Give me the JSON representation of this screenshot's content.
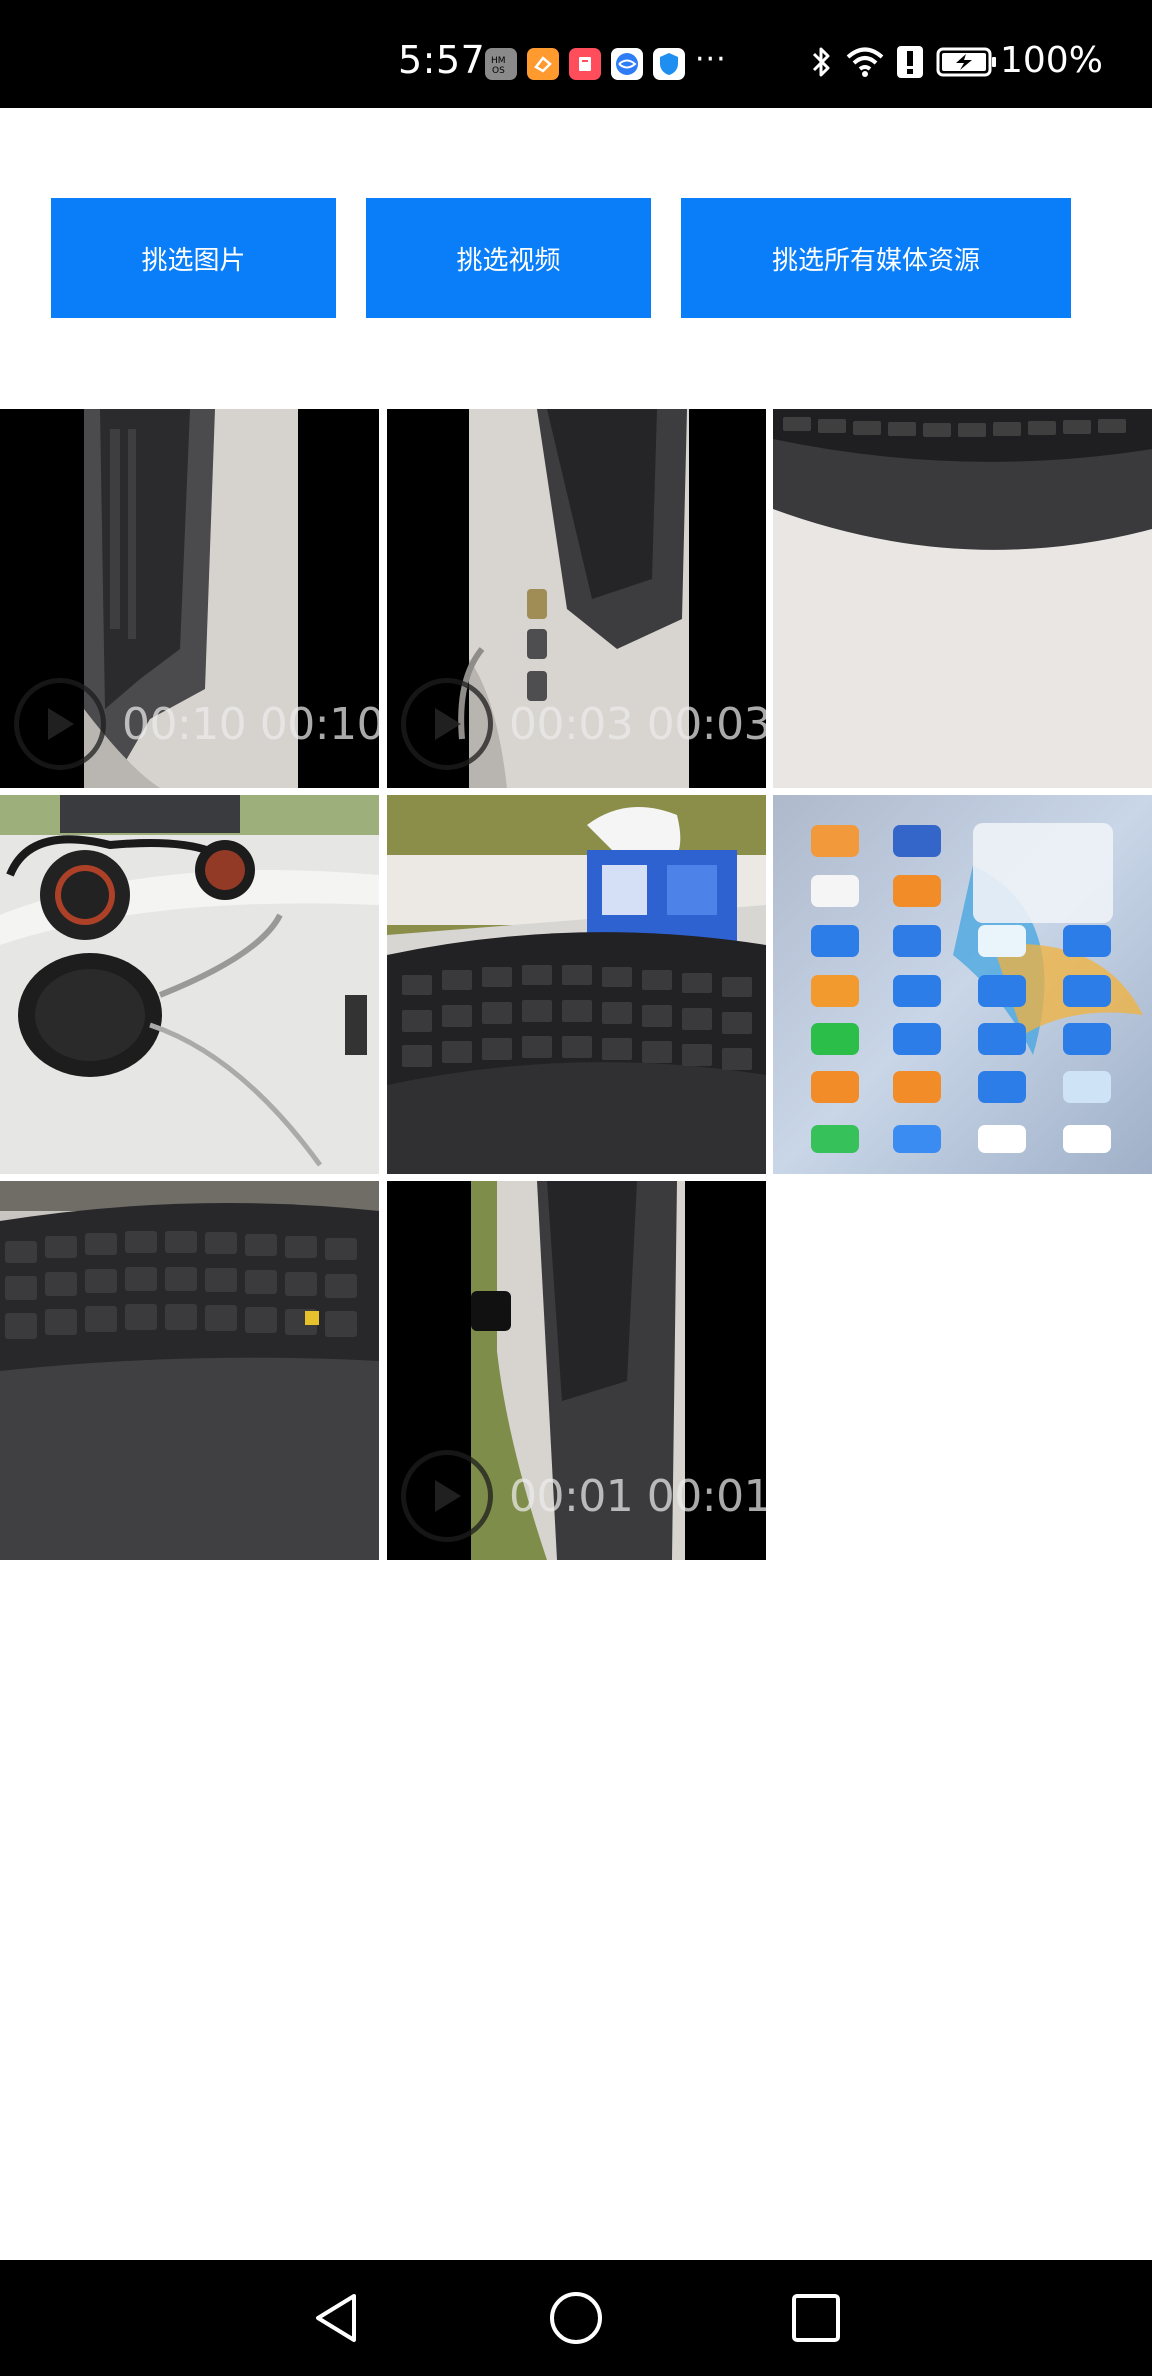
{
  "status_bar": {
    "time": "5:57",
    "battery_percent": "100%",
    "notification_icons": [
      "hmos-icon",
      "orange-app-icon",
      "red-app-icon",
      "browser-icon",
      "security-icon"
    ],
    "overflow": "···",
    "system_icons": [
      "bluetooth-icon",
      "wifi-icon",
      "alert-icon",
      "battery-charging-icon"
    ]
  },
  "buttons": {
    "pick_images": "挑选图片",
    "pick_videos": "挑选视频",
    "pick_all_media": "挑选所有媒体资源"
  },
  "media_grid": {
    "items": [
      {
        "type": "video",
        "duration": "00:10 00:10",
        "thumbnail": "keyboard-side-view"
      },
      {
        "type": "video",
        "duration": "00:03 00:03",
        "thumbnail": "keyboard-side-view"
      },
      {
        "type": "image",
        "thumbnail": "keyboard-edge-closeup"
      },
      {
        "type": "image",
        "thumbnail": "headset-on-desk"
      },
      {
        "type": "image",
        "thumbnail": "keyboard-and-tissue-box"
      },
      {
        "type": "image",
        "thumbnail": "phone-home-screen"
      },
      {
        "type": "image",
        "thumbnail": "keyboard-closeup"
      },
      {
        "type": "video",
        "duration": "00:01 00:01",
        "thumbnail": "keyboard-side-view"
      }
    ]
  },
  "nav_bar": {
    "buttons": [
      "back-icon",
      "home-icon",
      "recents-icon"
    ]
  },
  "colors": {
    "accent": "#0a7ef9",
    "status_bar_bg": "#000000",
    "nav_bar_bg": "#000000",
    "page_bg": "#ffffff"
  }
}
